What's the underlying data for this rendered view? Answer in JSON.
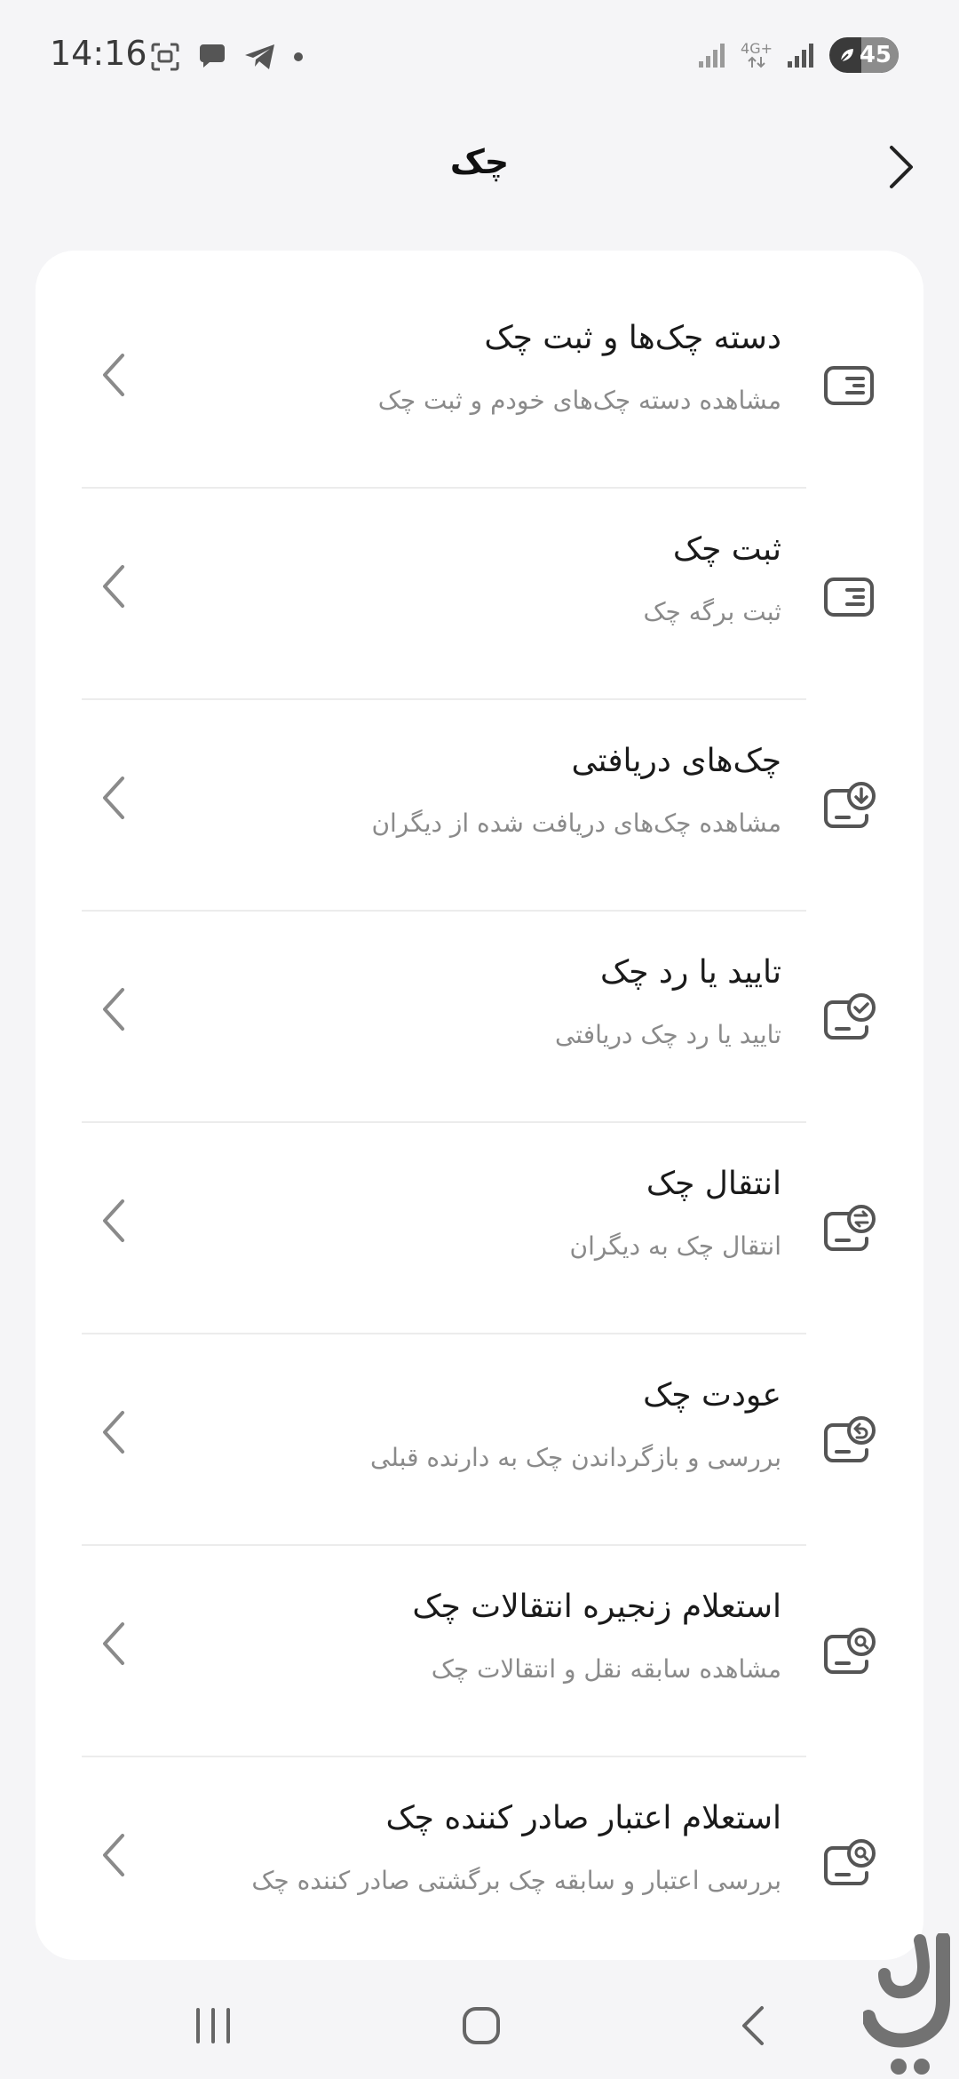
{
  "status_bar": {
    "time": "14:16",
    "network_label": "4G+",
    "battery_percent": "45"
  },
  "header": {
    "title": "چک"
  },
  "menu": {
    "items": [
      {
        "title": "دسته چک‌ها و ثبت چک",
        "subtitle": "مشاهده دسته چک‌های خودم و ثبت چک",
        "icon": "checkbook-icon"
      },
      {
        "title": "ثبت چک",
        "subtitle": "ثبت برگه چک",
        "icon": "check-register-icon"
      },
      {
        "title": "چک‌های دریافتی",
        "subtitle": "مشاهده چک‌های دریافت شده از دیگران",
        "icon": "check-received-icon"
      },
      {
        "title": "تایید یا رد چک",
        "subtitle": "تایید یا رد چک دریافتی",
        "icon": "check-approve-icon"
      },
      {
        "title": "انتقال چک",
        "subtitle": "انتقال چک به دیگران",
        "icon": "check-transfer-icon"
      },
      {
        "title": "عودت چک",
        "subtitle": "بررسی و بازگرداندن چک به دارنده قبلی",
        "icon": "check-return-icon"
      },
      {
        "title": "استعلام زنجیره انتقالات چک",
        "subtitle": "مشاهده سابقه نقل و انتقالات چک",
        "icon": "check-chain-inquiry-icon"
      },
      {
        "title": "استعلام اعتبار صادر کننده چک",
        "subtitle": "بررسی اعتبار و سابقه چک برگشتی صادر کننده چک",
        "icon": "issuer-credit-inquiry-icon"
      }
    ]
  },
  "colors": {
    "background": "#f5f5f7",
    "card": "#ffffff",
    "icon_stroke": "#555555",
    "subtitle": "#8a8a8a"
  }
}
